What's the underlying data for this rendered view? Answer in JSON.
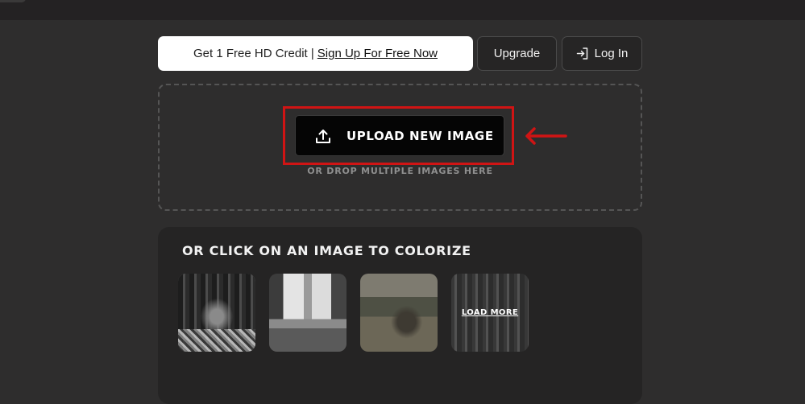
{
  "header": {
    "credit_prefix": "Get 1 Free HD Credit |",
    "signup_link": "Sign Up For Free Now",
    "upgrade_label": "Upgrade",
    "login_label": "Log In"
  },
  "upload": {
    "button_label": "UPLOAD NEW IMAGE",
    "drop_hint": "OR DROP MULTIPLE IMAGES HERE",
    "highlight_color": "#d01414"
  },
  "samples": {
    "title": "OR CLICK ON AN IMAGE TO COLORIZE",
    "load_more_label": "LOAD MORE"
  },
  "icons": {
    "upload": "upload-icon",
    "login": "login-icon",
    "arrow": "arrow-left-icon"
  }
}
